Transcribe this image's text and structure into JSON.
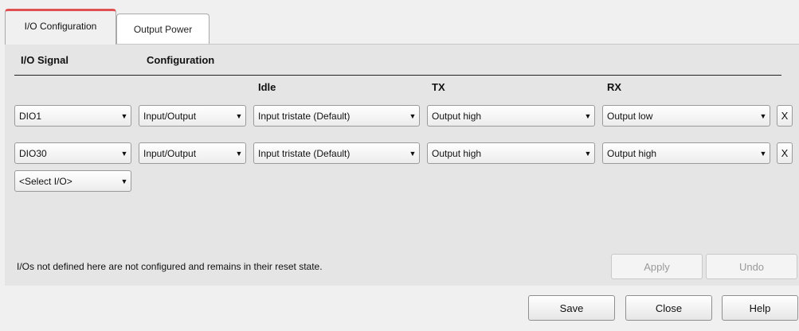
{
  "tabs": [
    {
      "label": "I/O Configuration",
      "active": true
    },
    {
      "label": "Output Power",
      "active": false
    }
  ],
  "headers": {
    "io_signal": "I/O Signal",
    "configuration": "Configuration",
    "idle": "Idle",
    "tx": "TX",
    "rx": "RX"
  },
  "rows": [
    {
      "signal": "DIO1",
      "config": "Input/Output",
      "idle": "Input tristate (Default)",
      "tx": "Output high",
      "rx": "Output low",
      "remove": "X"
    },
    {
      "signal": "DIO30",
      "config": "Input/Output",
      "idle": "Input tristate (Default)",
      "tx": "Output high",
      "rx": "Output high",
      "remove": "X"
    }
  ],
  "add_select": {
    "value": "<Select I/O>"
  },
  "note": "I/Os not defined here are not configured and remains in their reset state.",
  "panel_buttons": {
    "apply": "Apply",
    "undo": "Undo"
  },
  "dialog_buttons": {
    "save": "Save",
    "close": "Close",
    "help": "Help"
  },
  "colors": {
    "active_tab_accent": "#e05050",
    "panel_bg": "#e5e5e5",
    "disabled_text": "#9a9a9a"
  }
}
